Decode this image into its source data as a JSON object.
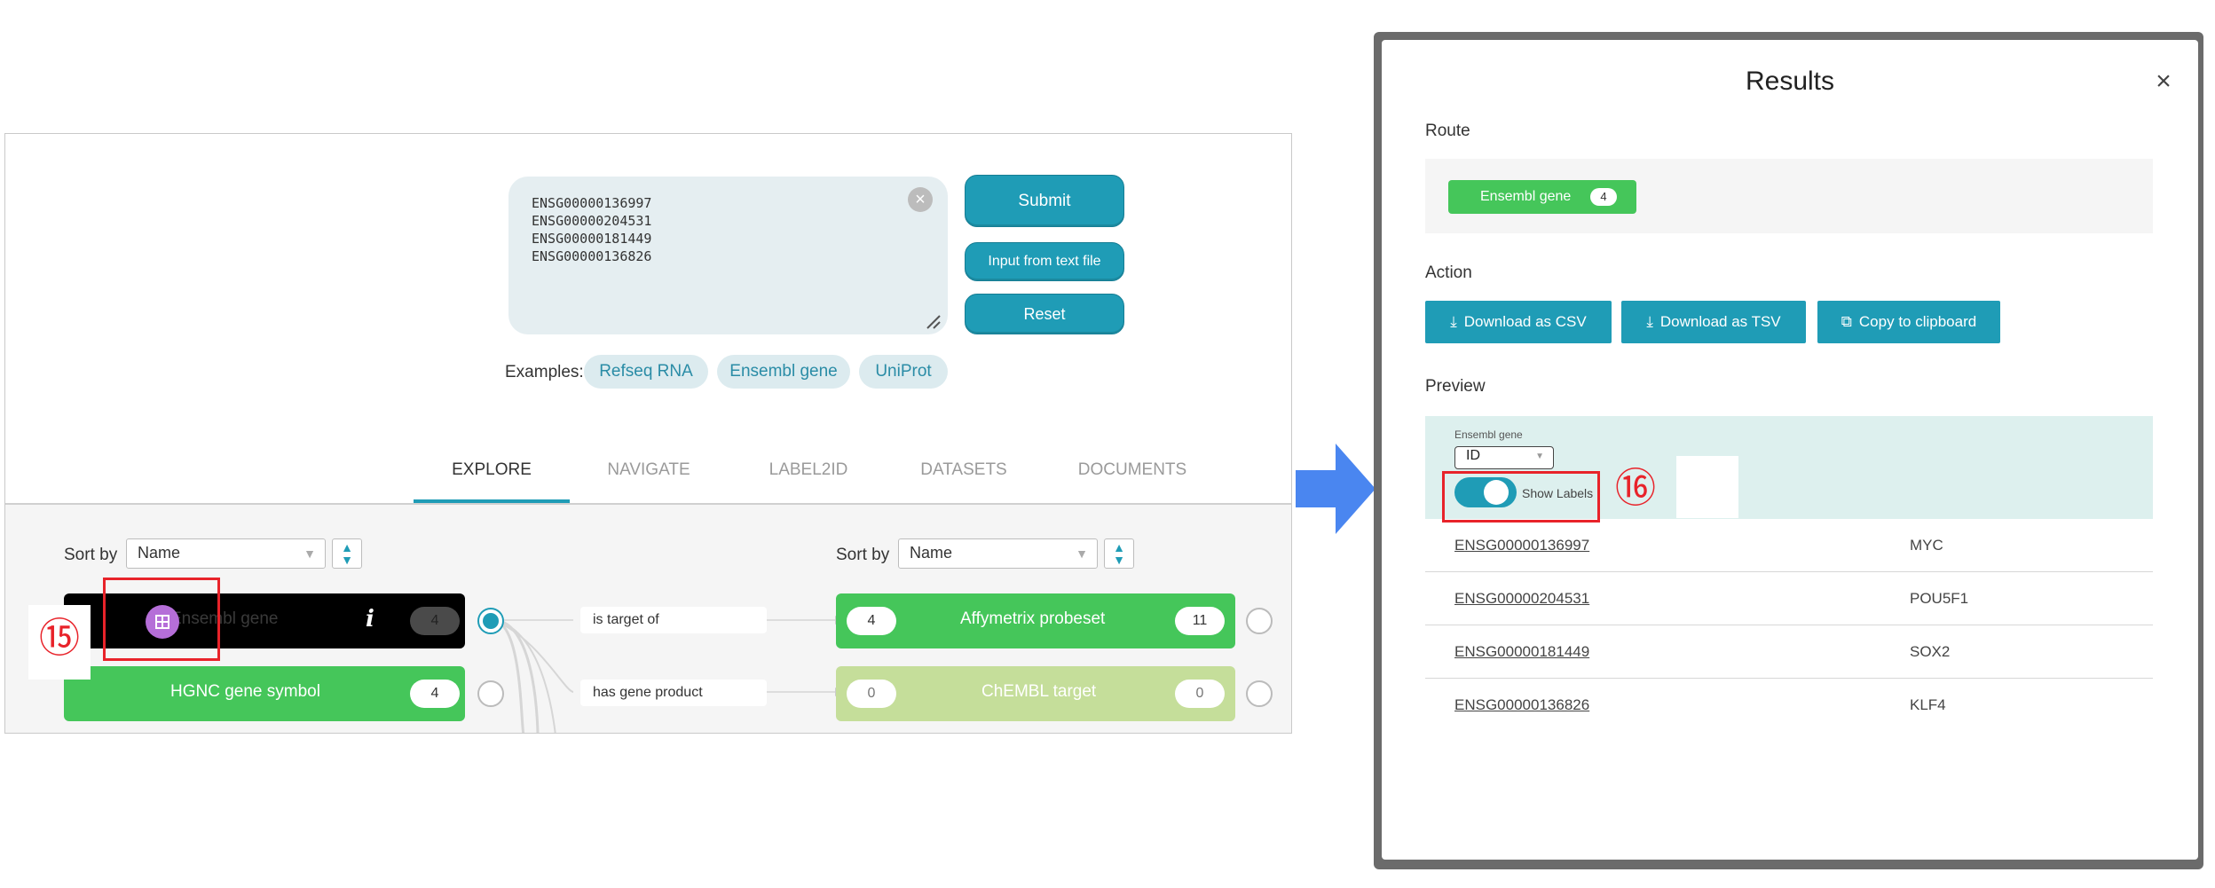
{
  "left_panel": {
    "textarea_value": "ENSG00000136997\nENSG00000204531\nENSG00000181449\nENSG00000136826",
    "buttons": {
      "submit": "Submit",
      "input_file": "Input from text file",
      "reset": "Reset"
    },
    "examples": {
      "label": "Examples:",
      "items": [
        "Refseq RNA",
        "Ensembl gene",
        "UniProt"
      ]
    },
    "tabs": [
      "EXPLORE",
      "NAVIGATE",
      "LABEL2ID",
      "DATASETS",
      "DOCUMENTS"
    ],
    "active_tab": "EXPLORE",
    "sort_left": {
      "label": "Sort by",
      "value": "Name"
    },
    "sort_right": {
      "label": "Sort by",
      "value": "Name"
    },
    "source_nodes": [
      {
        "label": "Ensembl gene",
        "count": "4",
        "info": "i",
        "color": "#000000"
      },
      {
        "label": "HGNC gene symbol",
        "count": "4",
        "color": "#45c65a"
      }
    ],
    "edges": [
      "is target of",
      "has gene product"
    ],
    "target_nodes": [
      {
        "label": "Affymetrix probeset",
        "left_count": "4",
        "right_count": "11",
        "color": "#45c65a"
      },
      {
        "label": "ChEMBL target",
        "left_count": "0",
        "right_count": "0",
        "color": "#c5de9a"
      }
    ],
    "annotation": "⑮"
  },
  "modal": {
    "title": "Results",
    "close": "×",
    "route_label": "Route",
    "route_chip": {
      "label": "Ensembl gene",
      "count": "4"
    },
    "action_label": "Action",
    "actions": [
      "Download as CSV",
      "Download as TSV",
      "Copy to clipboard"
    ],
    "preview_label": "Preview",
    "preview": {
      "column_label": "Ensembl gene",
      "column_select": "ID",
      "toggle_text": "Show Labels"
    },
    "rows": [
      {
        "id": "ENSG00000136997",
        "symbol": "MYC"
      },
      {
        "id": "ENSG00000204531",
        "symbol": "POU5F1"
      },
      {
        "id": "ENSG00000181449",
        "symbol": "SOX2"
      },
      {
        "id": "ENSG00000136826",
        "symbol": "KLF4"
      }
    ],
    "annotation": "⑯"
  },
  "colors": {
    "accent": "#1f9cb6",
    "node_green": "#45c65a",
    "node_pale_green": "#c5de9a",
    "annotation_red": "#e8232a",
    "arrow_blue": "#4a86f0"
  }
}
